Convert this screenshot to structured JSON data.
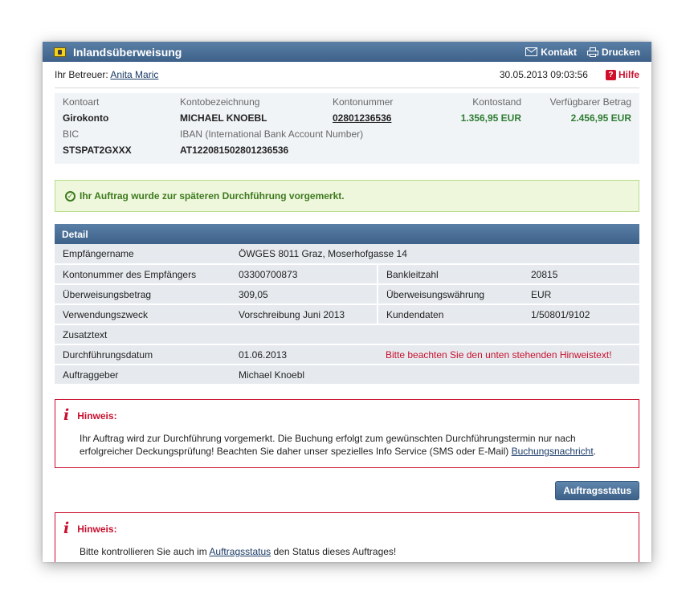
{
  "window": {
    "title": "Inlandsüberweisung",
    "actions": {
      "kontakt": "Kontakt",
      "drucken": "Drucken"
    }
  },
  "topinfo": {
    "betreuer_label": "Ihr Betreuer:",
    "betreuer_name": "Anita Maric",
    "datetime": "30.05.2013 09:03:56",
    "hilfe": "Hilfe"
  },
  "account": {
    "kontoart_label": "Kontoart",
    "kontoart": "Girokonto",
    "kontobezeichnung_label": "Kontobezeichnung",
    "kontobezeichnung": "MICHAEL KNOEBL",
    "kontonummer_label": "Kontonummer",
    "kontonummer": "02801236536",
    "kontostand_label": "Kontostand",
    "kontostand": "1.356,95 EUR",
    "verfuegbar_label": "Verfügbarer Betrag",
    "verfuegbar": "2.456,95 EUR",
    "bic_label": "BIC",
    "bic": "STSPAT2GXXX",
    "iban_label": "IBAN (International Bank Account Number)",
    "iban": "AT122081502801236536"
  },
  "success_message": "Ihr Auftrag wurde zur späteren Durchführung vorgemerkt.",
  "detail": {
    "header": "Detail",
    "empfaengername_label": "Empfängername",
    "empfaengername": "ÖWGES 8011 Graz, Moserhofgasse 14",
    "kontonummer_label": "Kontonummer des Empfängers",
    "kontonummer": "03300700873",
    "bankleitzahl_label": "Bankleitzahl",
    "bankleitzahl": "20815",
    "betrag_label": "Überweisungsbetrag",
    "betrag": "309,05",
    "waehrung_label": "Überweisungswährung",
    "waehrung": "EUR",
    "zweck_label": "Verwendungszweck",
    "zweck": "Vorschreibung Juni 2013",
    "kundendaten_label": "Kundendaten",
    "kundendaten": "1/50801/9102",
    "zusatztext_label": "Zusatztext",
    "datum_label": "Durchführungsdatum",
    "datum": "01.06.2013",
    "datum_warning": "Bitte beachten Sie den unten stehenden Hinweistext!",
    "auftraggeber_label": "Auftraggeber",
    "auftraggeber": "Michael Knoebl"
  },
  "hinweis1": {
    "title": "Hinweis:",
    "text_line1": "Ihr Auftrag wird zur Durchführung vorgemerkt. Die Buchung erfolgt zum gewünschten Durchführungstermin nur nach",
    "text_line2": "erfolgreicher Deckungsprüfung! Beachten Sie daher unser spezielles Info Service (SMS oder E-Mail)",
    "link": "Buchungsnachricht",
    "text_end": "."
  },
  "auftragsstatus_button": "Auftragsstatus",
  "hinweis2": {
    "title": "Hinweis:",
    "text_before": "Bitte kontrollieren Sie auch im",
    "link": "Auftragsstatus",
    "text_after": "den Status dieses Auftrages!"
  }
}
